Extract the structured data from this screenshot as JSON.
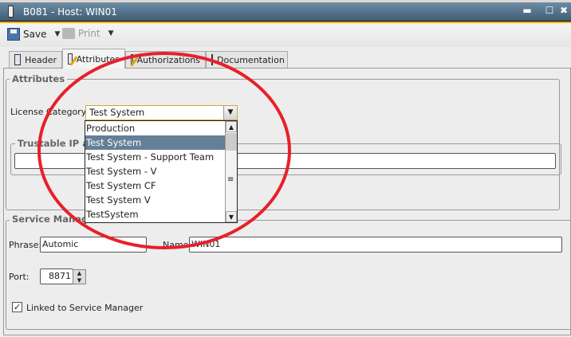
{
  "window": {
    "title": "B081 - Host: WIN01",
    "minimize": "▬",
    "maximize": "☐",
    "close": "✖"
  },
  "toolbar": {
    "save_label": "Save",
    "print_label": "Print",
    "dropdown_caret": "▼"
  },
  "tabs": [
    {
      "label": "Header"
    },
    {
      "label": "Attributes",
      "active": true
    },
    {
      "label": "Authorizations"
    },
    {
      "label": "Documentation"
    }
  ],
  "attributes": {
    "group_label": "Attributes",
    "license_label": "License Category:",
    "license_value": "Test System",
    "license_options": [
      "Production",
      "Test System",
      "Test System - Support Team",
      "Test System - V",
      "Test System CF",
      "Test System V",
      "TestSystem"
    ],
    "selected_option": "Test System",
    "trustable_label": "Trustable IP ad",
    "trustable_value": ""
  },
  "service_manager": {
    "group_label": "Service Manager",
    "phrase_label": "Phrase:",
    "phrase_value": "Automic",
    "name_label": "Name:",
    "name_value": "WIN01",
    "port_label": "Port:",
    "port_value": "8871",
    "linked_label": "Linked to Service Manager",
    "linked_checked": true
  },
  "colors": {
    "selection": "#647f97",
    "annotation": "#e8202a",
    "accent": "#f2ad00"
  }
}
